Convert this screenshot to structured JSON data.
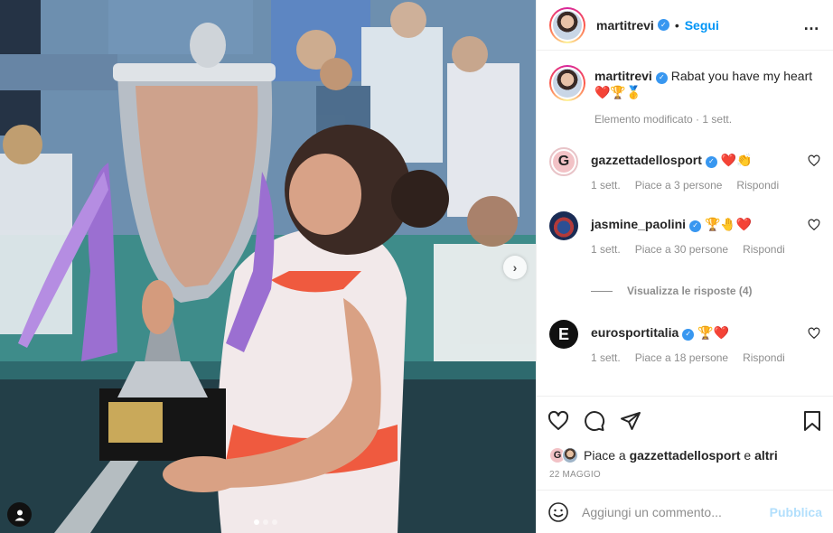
{
  "header": {
    "username": "martitrevi",
    "separator": "•",
    "follow_label": "Segui",
    "more_icon": "…"
  },
  "caption": {
    "username": "martitrevi",
    "text": "Rabat you have my heart",
    "emojis": "❤️🏆🥇",
    "edited": "Elemento modificato · 1 sett."
  },
  "comments": [
    {
      "username": "gazzettadellosport",
      "text": "❤️👏",
      "time": "1 sett.",
      "likes": "Piace a 3 persone",
      "reply": "Rispondi",
      "avatar_letter": "G"
    },
    {
      "username": "jasmine_paolini",
      "text": "🏆🤚❤️",
      "time": "1 sett.",
      "likes": "Piace a 30 persone",
      "reply": "Rispondi"
    },
    {
      "username": "eurosportitalia",
      "text": "🏆❤️",
      "time": "1 sett.",
      "likes": "Piace a 18 persone",
      "reply": "Rispondi",
      "avatar_letter": "E"
    }
  ],
  "view_replies": "Visualizza le risposte (4)",
  "likes": {
    "prefix": "Piace a ",
    "user": "gazzettadellosport",
    "middle": " e ",
    "others": "altri",
    "avatar_letter": "G"
  },
  "date": "22 MAGGIO",
  "add_comment": {
    "placeholder": "Aggiungi un commento...",
    "publish": "Pubblica"
  },
  "carousel": {
    "next": "›",
    "count": 3,
    "active": 0
  },
  "colors": {
    "accent": "#0095f6",
    "verified": "#3897f0",
    "muted": "#8e8e8e"
  }
}
